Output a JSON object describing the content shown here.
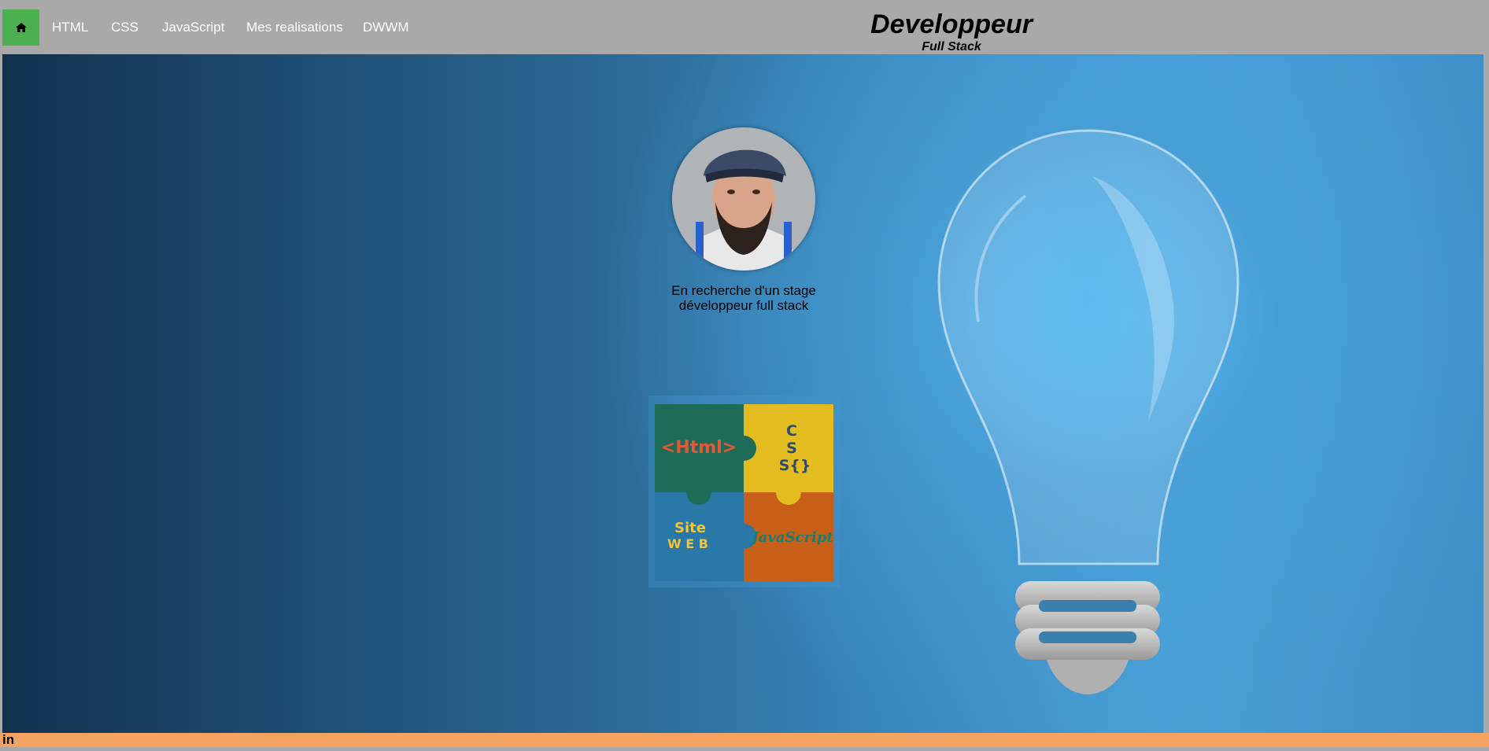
{
  "nav": {
    "home_icon": "home-icon",
    "links": [
      "HTML",
      "CSS",
      "JavaScript",
      "Mes realisations",
      "DWWM"
    ]
  },
  "brand": {
    "title": "Developpeur",
    "subtitle": "Full Stack"
  },
  "hero": {
    "tagline_line1": "En recherche d'un stage",
    "tagline_line2": "développeur full stack",
    "puzzle": {
      "html": "<Html>",
      "css_1": "C",
      "css_2": "S",
      "css_3": "S{}",
      "site": "Site",
      "web": "W E B",
      "js": "JavaScript"
    }
  },
  "footer": {
    "linkedin_label": "in"
  },
  "colors": {
    "nav_bg": "#a9a9a9",
    "home_button": "#4caf50",
    "footer_bg": "#f4a460",
    "puzzle_green": "#1e6b57",
    "puzzle_yellow": "#e3bd1f",
    "puzzle_blue": "#2a78a8",
    "puzzle_orange": "#c75f18"
  }
}
